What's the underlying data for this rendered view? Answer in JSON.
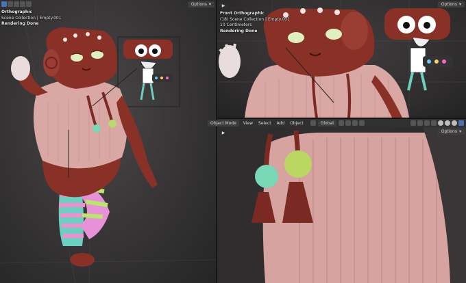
{
  "left_viewport": {
    "overlay": {
      "view": "Orthographic",
      "collection": "Scene Collection | Empty.001",
      "status": "Rendering Done"
    },
    "options_label": "Options"
  },
  "top_right_viewport": {
    "overlay": {
      "view": "Front Orthographic",
      "collection": "(18) Scene Collection | Empty.001",
      "scale": "10 Centimeters",
      "status": "Rendering Done"
    },
    "options_label": "Options"
  },
  "bottom_right_viewport": {
    "header": {
      "mode": "Object Mode",
      "menu": [
        "View",
        "Select",
        "Add",
        "Object"
      ],
      "orientation": "Global"
    },
    "options_label": "Options"
  },
  "colors": {
    "accent": "#4772b3",
    "ui_bg": "#303030",
    "character_red": "#8a3127",
    "sweater_pink": "#d9a7a4"
  }
}
